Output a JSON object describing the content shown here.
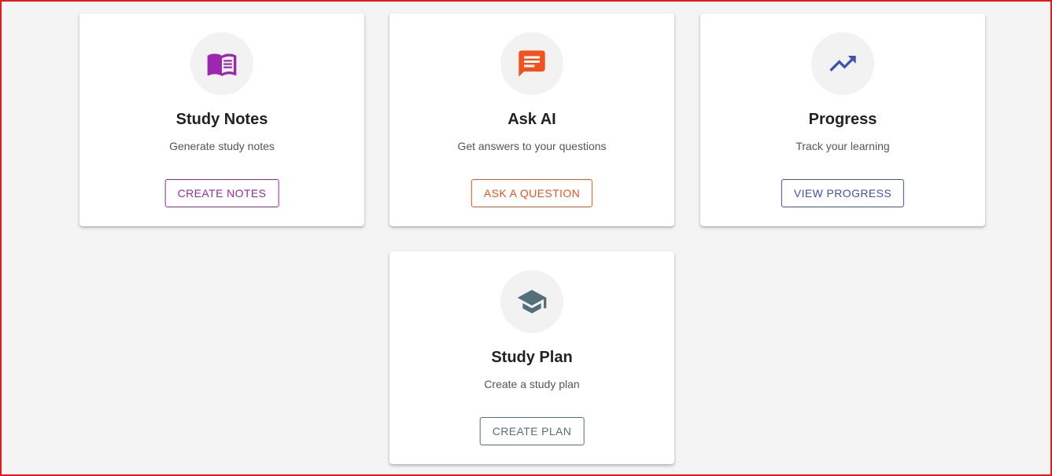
{
  "cards": [
    {
      "title": "Study Notes",
      "subtitle": "Generate study notes",
      "button_label": "CREATE NOTES",
      "icon": "book-icon",
      "accent": "#9c27b0"
    },
    {
      "title": "Ask AI",
      "subtitle": "Get answers to your questions",
      "button_label": "ASK A QUESTION",
      "icon": "chat-icon",
      "accent": "#f4511e"
    },
    {
      "title": "Progress",
      "subtitle": "Track your learning",
      "button_label": "VIEW PROGRESS",
      "icon": "trending-up-icon",
      "accent": "#3f51b5"
    },
    {
      "title": "Study Plan",
      "subtitle": "Create a study plan",
      "button_label": "CREATE PLAN",
      "icon": "graduation-cap-icon",
      "accent": "#546e7a"
    }
  ],
  "colors": {
    "background": "#f4f4f4",
    "frame_border": "#e41b1b"
  }
}
